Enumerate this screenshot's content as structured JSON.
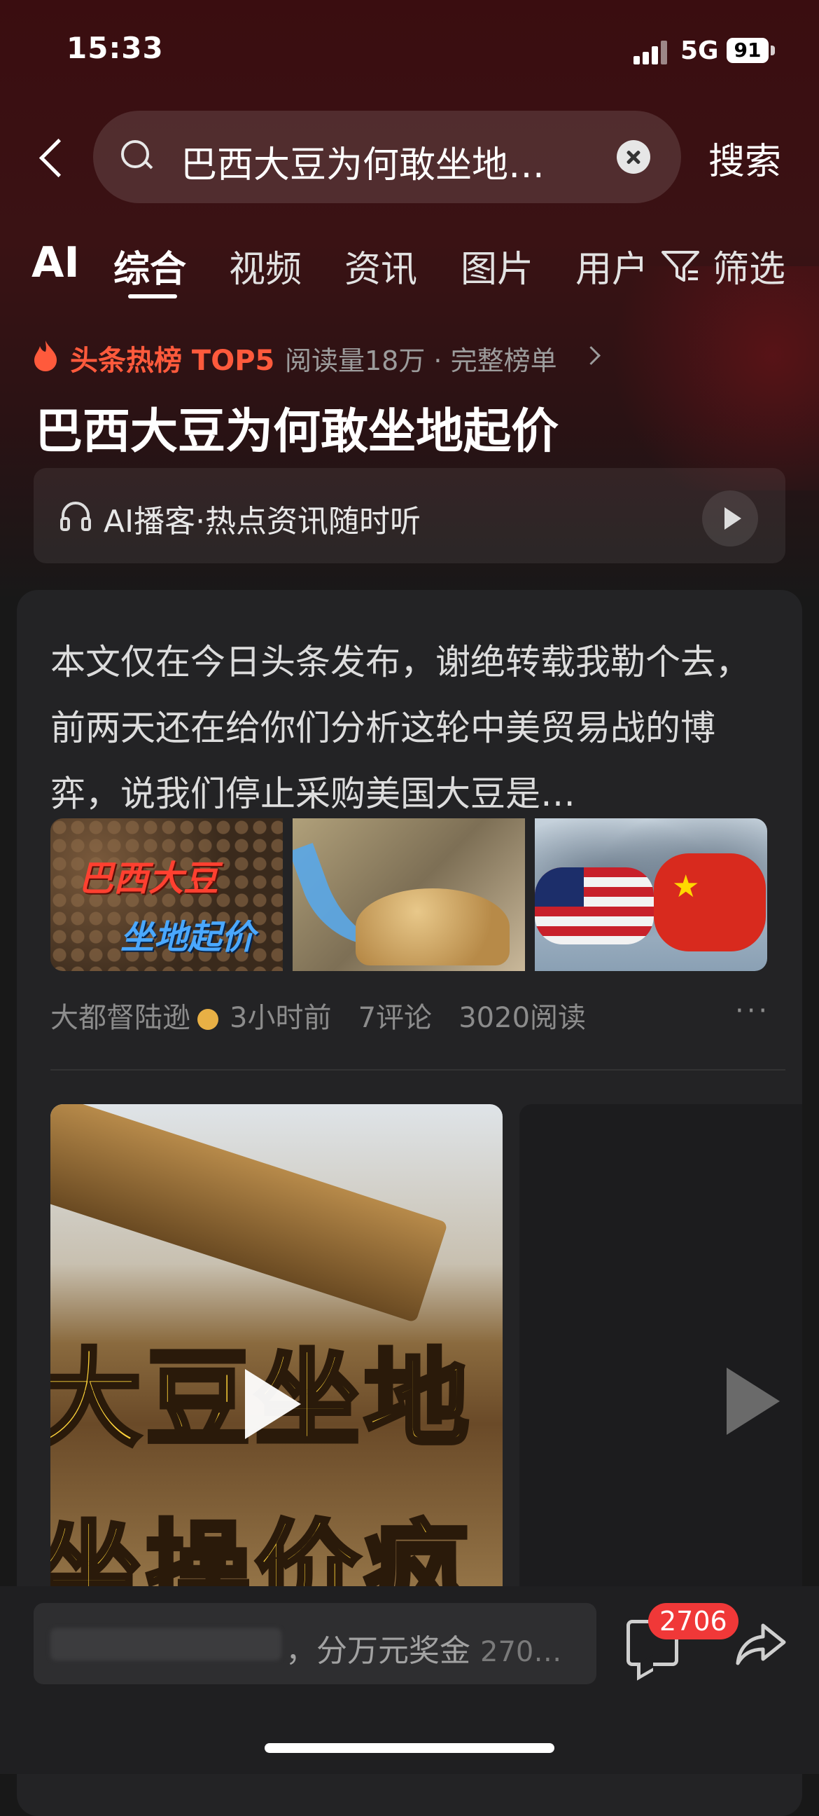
{
  "status_bar": {
    "time": "15:33",
    "network": "5G",
    "battery": "91"
  },
  "search": {
    "query": "巴西大豆为何敢坐地…",
    "button_label": "搜索"
  },
  "tabs": {
    "ai_label": "AI",
    "items": [
      {
        "label": "综合",
        "active": true
      },
      {
        "label": "视频"
      },
      {
        "label": "资讯"
      },
      {
        "label": "图片"
      },
      {
        "label": "用户"
      }
    ],
    "filter_label": "筛选"
  },
  "hot": {
    "label": "头条热榜 TOP5",
    "meta": "阅读量18万 · 完整榜单",
    "title": "巴西大豆为何敢坐地起价"
  },
  "podcast": {
    "label": "AI播客·热点资讯随时听"
  },
  "article": {
    "excerpt": "本文仅在今日头条发布，谢绝转载我勒个去，前两天还在给你们分析这轮中美贸易战的博弈，说我们停止采购美国大豆是…",
    "thumb1_line1": "巴西大豆",
    "thumb1_line2": "坐地起价",
    "author": "大都督陆逊",
    "time": "3小时前",
    "comments": "7评论",
    "reads": "3020阅读",
    "more": "···"
  },
  "video": {
    "line1": "大豆坐地",
    "line2": "坐操价疯"
  },
  "bottom": {
    "comment_placeholder": "，分万元奖金",
    "comment_suffix": "270…",
    "comment_badge": "2706"
  },
  "colors": {
    "accent": "#ff5a3c",
    "badge": "#f03838",
    "background": "#181818"
  }
}
